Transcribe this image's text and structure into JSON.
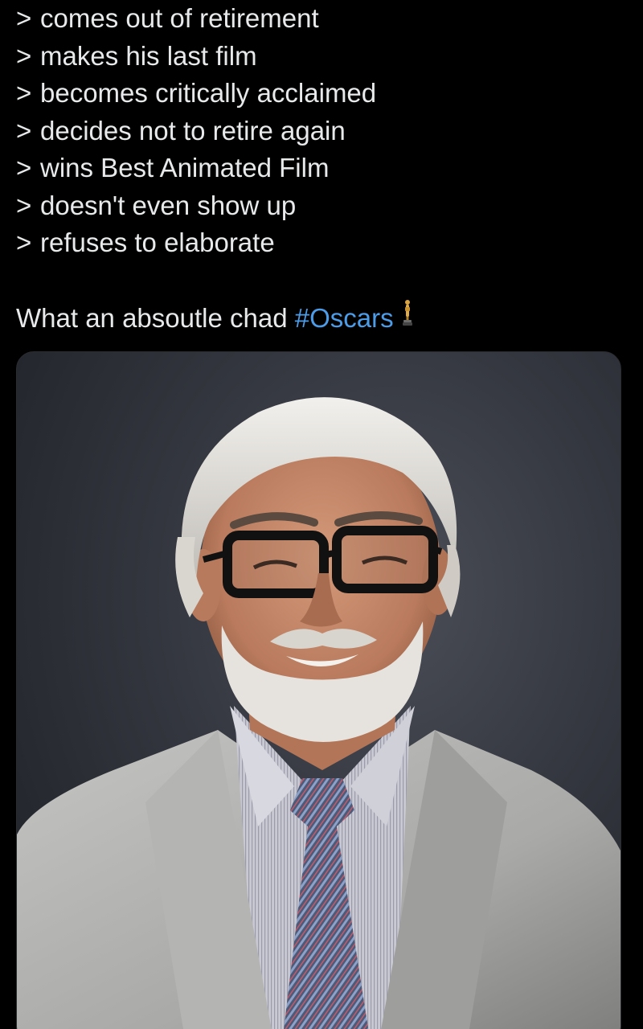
{
  "tweet": {
    "lines": [
      {
        "prefix": ">",
        "text": "comes out of retirement"
      },
      {
        "prefix": ">",
        "text": "makes his last film"
      },
      {
        "prefix": ">",
        "text": "becomes critically acclaimed"
      },
      {
        "prefix": ">",
        "text": "decides not to retire again"
      },
      {
        "prefix": ">",
        "text": "wins Best Animated Film"
      },
      {
        "prefix": ">",
        "text": "doesn't even show up"
      },
      {
        "prefix": ">",
        "text": "refuses to elaborate"
      }
    ],
    "caption": "What an absoutle chad",
    "hashtag": "#Oscars",
    "emoji_icon": "oscar-statuette-icon"
  },
  "media": {
    "icon": "portrait-photo"
  },
  "colors": {
    "background": "#000000",
    "text": "#e7e9ea",
    "hashtag": "#4d9ce8"
  }
}
